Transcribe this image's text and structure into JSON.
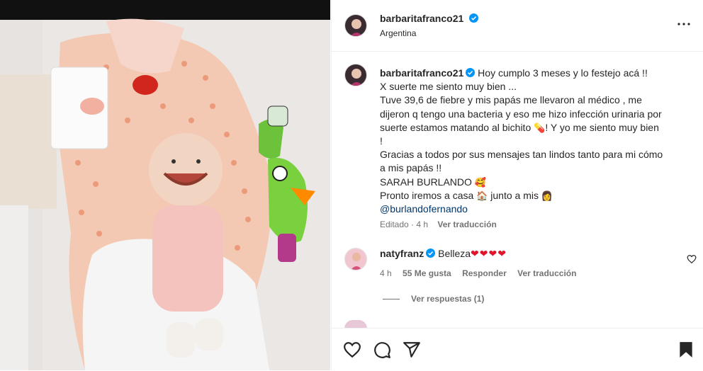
{
  "post": {
    "username": "barbaritafranco21",
    "location": "Argentina",
    "caption_username": "barbaritafranco21",
    "caption_lines": [
      "Hoy cumplo 3 meses y lo festejo acá !!",
      "X suerte me siento muy bien ...",
      "Tuve 39,6 de fiebre y mis papás me llevaron al médico , me",
      "dijeron q tengo una bacteria y eso me hizo infección urinaria por",
      "suerte estamos matando al bichito",
      "! Y yo me siento muy bien",
      "!",
      "Gracias a todos por sus mensajes tan lindos tanto para mi cómo",
      "a mis papás !!",
      "SARAH BURLANDO",
      "Pronto iremos a casa",
      "junto a mis",
      "@burlandofernando"
    ],
    "emoji": {
      "pill": "💊",
      "smile_hearts": "🥰",
      "house": "🏠",
      "woman": "👩"
    },
    "caption_meta": {
      "edited": "Editado",
      "time": "4 h",
      "translate": "Ver traducción"
    }
  },
  "comment": {
    "username": "natyfranz",
    "text": "Belleza",
    "hearts": "❤❤❤❤",
    "time": "4 h",
    "likes": "55 Me gusta",
    "reply": "Responder",
    "translate": "Ver traducción",
    "view_replies": "Ver respuestas (1)"
  },
  "icons": {
    "more": "more-horizontal-icon",
    "like": "heart-icon",
    "comment": "comment-icon",
    "share": "share-icon",
    "save": "bookmark-icon",
    "verified": "verified-badge-icon"
  },
  "colors": {
    "verified": "#0095f6",
    "link": "#00376b",
    "muted": "#737373",
    "heart": "#e0142b"
  }
}
